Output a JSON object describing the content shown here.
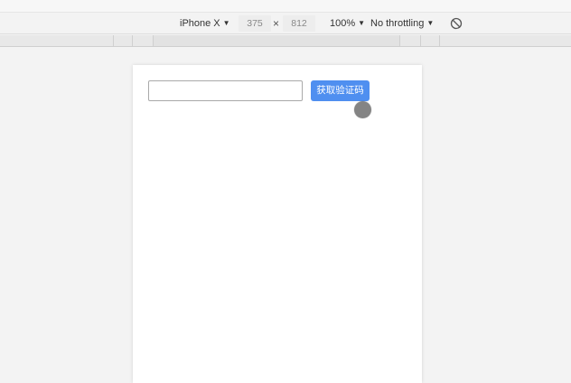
{
  "device_toolbar": {
    "device_name": "iPhone X",
    "width": "375",
    "times": "×",
    "height": "812",
    "zoom": "100%",
    "throttling": "No throttling"
  },
  "page": {
    "code_input": {
      "value": "",
      "placeholder": ""
    },
    "get_code_button": "获取验证码"
  },
  "colors": {
    "button": "#4f8ff0",
    "toolbar": "#f3f3f3"
  }
}
